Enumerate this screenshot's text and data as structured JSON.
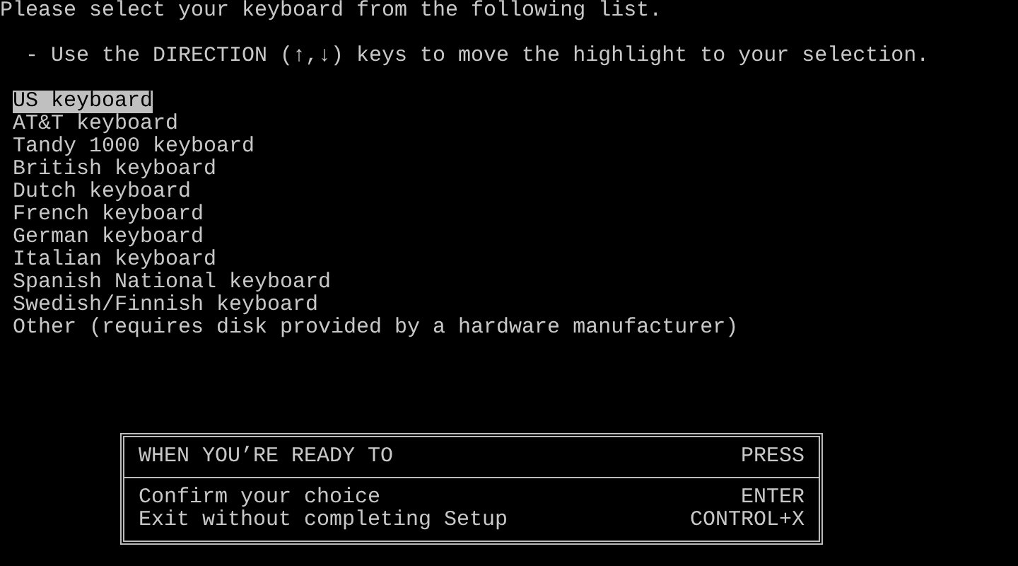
{
  "heading": "Please select your keyboard from the following list.",
  "instruction": "- Use the DIRECTION (↑,↓) keys to move the highlight to your selection.",
  "keyboards": [
    {
      "label": "US keyboard",
      "selected": true
    },
    {
      "label": "AT&T keyboard",
      "selected": false
    },
    {
      "label": "Tandy 1000 keyboard",
      "selected": false
    },
    {
      "label": "British keyboard",
      "selected": false
    },
    {
      "label": "Dutch keyboard",
      "selected": false
    },
    {
      "label": "French keyboard",
      "selected": false
    },
    {
      "label": "German keyboard",
      "selected": false
    },
    {
      "label": "Italian keyboard",
      "selected": false
    },
    {
      "label": "Spanish National keyboard",
      "selected": false
    },
    {
      "label": "Swedish/Finnish keyboard",
      "selected": false
    },
    {
      "label": "Other (requires disk provided by a hardware manufacturer)",
      "selected": false
    }
  ],
  "key_box": {
    "header_action": "WHEN YOU’RE READY TO",
    "header_key": "PRESS",
    "rows": [
      {
        "action": "Confirm your choice",
        "key": "ENTER"
      },
      {
        "action": "Exit without completing Setup",
        "key": "CONTROL+X"
      }
    ]
  }
}
